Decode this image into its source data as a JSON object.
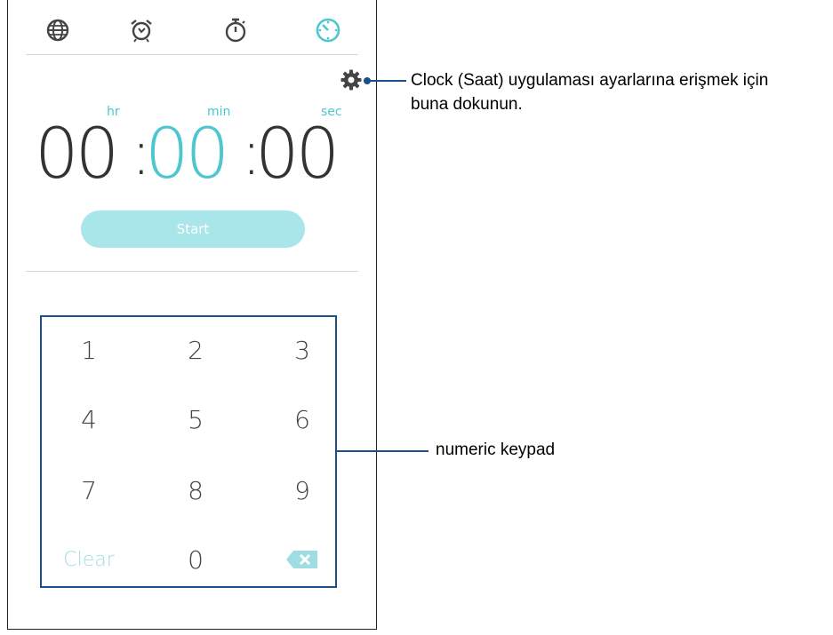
{
  "tabs": [
    {
      "name": "world-clock",
      "icon": "globe-icon",
      "active": false
    },
    {
      "name": "alarm",
      "icon": "alarm-clock-icon",
      "active": false
    },
    {
      "name": "stopwatch",
      "icon": "stopwatch-icon",
      "active": false
    },
    {
      "name": "timer",
      "icon": "timer-icon",
      "active": true
    }
  ],
  "timer": {
    "unit_hr": "hr",
    "unit_min": "min",
    "unit_sec": "sec",
    "hours": "00",
    "minutes": "00",
    "seconds": "00",
    "separator": ":"
  },
  "start_label": "Start",
  "keypad": {
    "keys": [
      "1",
      "2",
      "3",
      "4",
      "5",
      "6",
      "7",
      "8",
      "9"
    ],
    "clear_label": "Clear",
    "zero": "0",
    "backspace_icon": "backspace-icon"
  },
  "annotations": {
    "settings_line1": "Clock (Saat) uygulaması ayarlarına erişmek için",
    "settings_line2": "buna dokunun.",
    "keypad_label": "numeric keypad"
  },
  "colors": {
    "accent": "#4cc7cf",
    "start_button": "#a8e6ea",
    "callout": "#1a4f8a"
  }
}
